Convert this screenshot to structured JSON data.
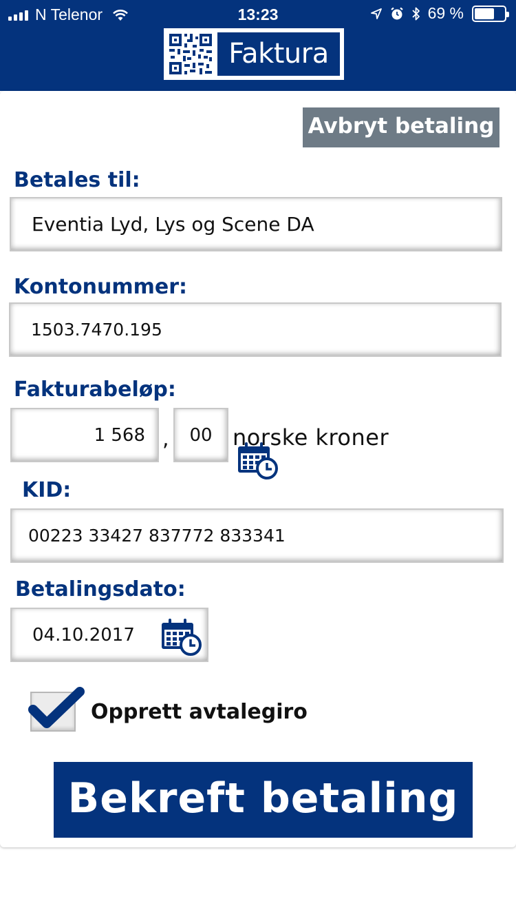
{
  "status_bar": {
    "carrier": "N Telenor",
    "time": "13:23",
    "battery_percent": "69 %",
    "battery_level": 0.69,
    "icons": [
      "signal-icon",
      "wifi-icon",
      "location-icon",
      "alarm-icon",
      "bluetooth-icon",
      "battery-icon"
    ]
  },
  "header": {
    "logo_text": "Faktura",
    "logo_icon": "qr-code-icon",
    "background_color": "#04337d"
  },
  "form": {
    "cancel_label": "Avbryt betaling",
    "payee_label": "Betales til:",
    "payee_value": "Eventia Lyd, Lys og Scene DA",
    "account_label": "Kontonummer:",
    "account_value": "1503.7470.195",
    "amount_label": "Fakturabeløp:",
    "amount_kroner": "1 568",
    "amount_separator": ",",
    "amount_ore": "00",
    "amount_unit": "norske kroner",
    "kid_label": "KID:",
    "kid_value": "00223 33427 837772 833341",
    "date_label": "Betalingsdato:",
    "date_value": "04.10.2017",
    "autogiro_label": "Opprett avtalegiro",
    "autogiro_checked": true,
    "confirm_label": "Bekreft betaling"
  },
  "colors": {
    "brand_blue": "#04337d",
    "cancel_gray": "#6e7b86"
  }
}
